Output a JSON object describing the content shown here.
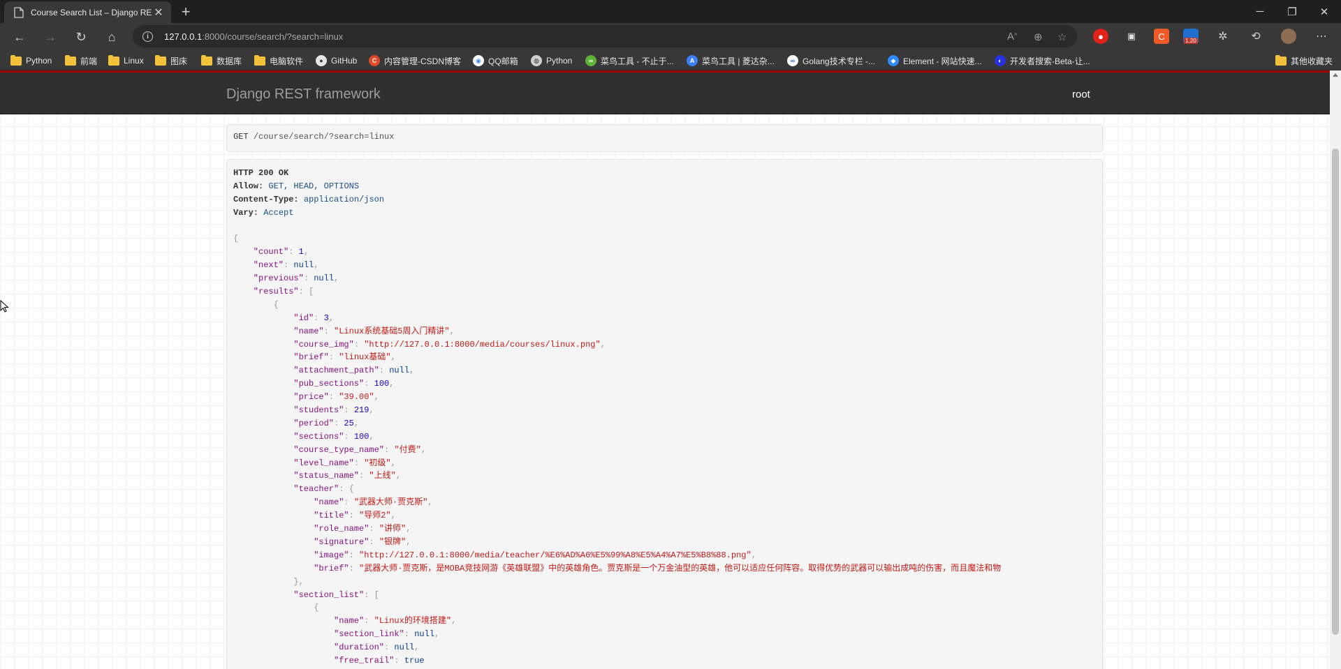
{
  "browser": {
    "tab_title": "Course Search List – Django REST",
    "url_host": "127.0.0.1",
    "url_rest": ":8000/course/search/?search=linux",
    "extensions_badge": "1.20",
    "bookmarks": [
      {
        "label": "Python",
        "icon": "folder-icon"
      },
      {
        "label": "前端",
        "icon": "folder-icon"
      },
      {
        "label": "Linux",
        "icon": "folder-icon"
      },
      {
        "label": "图床",
        "icon": "folder-icon"
      },
      {
        "label": "数据库",
        "icon": "folder-icon"
      },
      {
        "label": "电脑软件",
        "icon": "folder-icon"
      },
      {
        "label": "GitHub",
        "icon": "github-icon"
      },
      {
        "label": "内容管理-CSDN博客",
        "icon": "csdn-icon"
      },
      {
        "label": "QQ邮箱",
        "icon": "qq-mail-icon"
      },
      {
        "label": "Python",
        "icon": "python-icon"
      },
      {
        "label": "菜鸟工具 - 不止于...",
        "icon": "runoob-icon"
      },
      {
        "label": "菜鸟工具 | 菱达杂...",
        "icon": "a-circle-icon"
      },
      {
        "label": "Golang技术专栏 -...",
        "icon": "golang-icon"
      },
      {
        "label": "Element - 网站快速...",
        "icon": "element-icon"
      },
      {
        "label": "开发者搜索-Beta-让...",
        "icon": "baidu-icon"
      }
    ],
    "other_bookmarks": "其他收藏夹"
  },
  "app": {
    "brand": "Django REST framework",
    "user": "root"
  },
  "request": {
    "method": "GET",
    "path": "/course/search/?search=linux"
  },
  "response": {
    "status": "HTTP 200 OK",
    "headers": [
      {
        "key": "Allow:",
        "value": "GET, HEAD, OPTIONS"
      },
      {
        "key": "Content-Type:",
        "value": "application/json"
      },
      {
        "key": "Vary:",
        "value": "Accept"
      }
    ],
    "json_lines": [
      {
        "indent": 0,
        "parts": [
          [
            "p",
            "{"
          ]
        ]
      },
      {
        "indent": 1,
        "parts": [
          [
            "k",
            "\"count\""
          ],
          [
            "p",
            ": "
          ],
          [
            "n",
            "1"
          ],
          [
            "p",
            ","
          ]
        ]
      },
      {
        "indent": 1,
        "parts": [
          [
            "k",
            "\"next\""
          ],
          [
            "p",
            ": "
          ],
          [
            "lit",
            "null"
          ],
          [
            "p",
            ","
          ]
        ]
      },
      {
        "indent": 1,
        "parts": [
          [
            "k",
            "\"previous\""
          ],
          [
            "p",
            ": "
          ],
          [
            "lit",
            "null"
          ],
          [
            "p",
            ","
          ]
        ]
      },
      {
        "indent": 1,
        "parts": [
          [
            "k",
            "\"results\""
          ],
          [
            "p",
            ": ["
          ]
        ]
      },
      {
        "indent": 2,
        "parts": [
          [
            "p",
            "{"
          ]
        ]
      },
      {
        "indent": 3,
        "parts": [
          [
            "k",
            "\"id\""
          ],
          [
            "p",
            ": "
          ],
          [
            "n",
            "3"
          ],
          [
            "p",
            ","
          ]
        ]
      },
      {
        "indent": 3,
        "parts": [
          [
            "k",
            "\"name\""
          ],
          [
            "p",
            ": "
          ],
          [
            "s",
            "\"Linux系统基础5周入门精讲\""
          ],
          [
            "p",
            ","
          ]
        ]
      },
      {
        "indent": 3,
        "parts": [
          [
            "k",
            "\"course_img\""
          ],
          [
            "p",
            ": "
          ],
          [
            "s",
            "\"http://127.0.0.1:8000/media/courses/linux.png\""
          ],
          [
            "p",
            ","
          ]
        ]
      },
      {
        "indent": 3,
        "parts": [
          [
            "k",
            "\"brief\""
          ],
          [
            "p",
            ": "
          ],
          [
            "s",
            "\"linux基础\""
          ],
          [
            "p",
            ","
          ]
        ]
      },
      {
        "indent": 3,
        "parts": [
          [
            "k",
            "\"attachment_path\""
          ],
          [
            "p",
            ": "
          ],
          [
            "lit",
            "null"
          ],
          [
            "p",
            ","
          ]
        ]
      },
      {
        "indent": 3,
        "parts": [
          [
            "k",
            "\"pub_sections\""
          ],
          [
            "p",
            ": "
          ],
          [
            "n",
            "100"
          ],
          [
            "p",
            ","
          ]
        ]
      },
      {
        "indent": 3,
        "parts": [
          [
            "k",
            "\"price\""
          ],
          [
            "p",
            ": "
          ],
          [
            "s",
            "\"39.00\""
          ],
          [
            "p",
            ","
          ]
        ]
      },
      {
        "indent": 3,
        "parts": [
          [
            "k",
            "\"students\""
          ],
          [
            "p",
            ": "
          ],
          [
            "n",
            "219"
          ],
          [
            "p",
            ","
          ]
        ]
      },
      {
        "indent": 3,
        "parts": [
          [
            "k",
            "\"period\""
          ],
          [
            "p",
            ": "
          ],
          [
            "n",
            "25"
          ],
          [
            "p",
            ","
          ]
        ]
      },
      {
        "indent": 3,
        "parts": [
          [
            "k",
            "\"sections\""
          ],
          [
            "p",
            ": "
          ],
          [
            "n",
            "100"
          ],
          [
            "p",
            ","
          ]
        ]
      },
      {
        "indent": 3,
        "parts": [
          [
            "k",
            "\"course_type_name\""
          ],
          [
            "p",
            ": "
          ],
          [
            "s",
            "\"付费\""
          ],
          [
            "p",
            ","
          ]
        ]
      },
      {
        "indent": 3,
        "parts": [
          [
            "k",
            "\"level_name\""
          ],
          [
            "p",
            ": "
          ],
          [
            "s",
            "\"初级\""
          ],
          [
            "p",
            ","
          ]
        ]
      },
      {
        "indent": 3,
        "parts": [
          [
            "k",
            "\"status_name\""
          ],
          [
            "p",
            ": "
          ],
          [
            "s",
            "\"上线\""
          ],
          [
            "p",
            ","
          ]
        ]
      },
      {
        "indent": 3,
        "parts": [
          [
            "k",
            "\"teacher\""
          ],
          [
            "p",
            ": {"
          ]
        ]
      },
      {
        "indent": 4,
        "parts": [
          [
            "k",
            "\"name\""
          ],
          [
            "p",
            ": "
          ],
          [
            "s",
            "\"武器大师·贾克斯\""
          ],
          [
            "p",
            ","
          ]
        ]
      },
      {
        "indent": 4,
        "parts": [
          [
            "k",
            "\"title\""
          ],
          [
            "p",
            ": "
          ],
          [
            "s",
            "\"导师2\""
          ],
          [
            "p",
            ","
          ]
        ]
      },
      {
        "indent": 4,
        "parts": [
          [
            "k",
            "\"role_name\""
          ],
          [
            "p",
            ": "
          ],
          [
            "s",
            "\"讲师\""
          ],
          [
            "p",
            ","
          ]
        ]
      },
      {
        "indent": 4,
        "parts": [
          [
            "k",
            "\"signature\""
          ],
          [
            "p",
            ": "
          ],
          [
            "s",
            "\"银牌\""
          ],
          [
            "p",
            ","
          ]
        ]
      },
      {
        "indent": 4,
        "parts": [
          [
            "k",
            "\"image\""
          ],
          [
            "p",
            ": "
          ],
          [
            "s",
            "\"http://127.0.0.1:8000/media/teacher/%E6%AD%A6%E5%99%A8%E5%A4%A7%E5%B8%88.png\""
          ],
          [
            "p",
            ","
          ]
        ]
      },
      {
        "indent": 4,
        "parts": [
          [
            "k",
            "\"brief\""
          ],
          [
            "p",
            ": "
          ],
          [
            "s",
            "\"武器大师·贾克斯，是MOBA竞技网游《英雄联盟》中的英雄角色。贾克斯是一个万金油型的英雄，他可以适应任何阵容。取得优势的武器可以输出成吨的伤害，而且魔法和物"
          ]
        ]
      },
      {
        "indent": 3,
        "parts": [
          [
            "p",
            "},"
          ]
        ]
      },
      {
        "indent": 3,
        "parts": [
          [
            "k",
            "\"section_list\""
          ],
          [
            "p",
            ": ["
          ]
        ]
      },
      {
        "indent": 4,
        "parts": [
          [
            "p",
            "{"
          ]
        ]
      },
      {
        "indent": 5,
        "parts": [
          [
            "k",
            "\"name\""
          ],
          [
            "p",
            ": "
          ],
          [
            "s",
            "\"Linux的环境搭建\""
          ],
          [
            "p",
            ","
          ]
        ]
      },
      {
        "indent": 5,
        "parts": [
          [
            "k",
            "\"section_link\""
          ],
          [
            "p",
            ": "
          ],
          [
            "lit",
            "null"
          ],
          [
            "p",
            ","
          ]
        ]
      },
      {
        "indent": 5,
        "parts": [
          [
            "k",
            "\"duration\""
          ],
          [
            "p",
            ": "
          ],
          [
            "lit",
            "null"
          ],
          [
            "p",
            ","
          ]
        ]
      },
      {
        "indent": 5,
        "parts": [
          [
            "k",
            "\"free_trail\""
          ],
          [
            "p",
            ": "
          ],
          [
            "lit",
            "true"
          ]
        ]
      },
      {
        "indent": 4,
        "parts": [
          [
            "p",
            "},"
          ]
        ]
      }
    ]
  },
  "colors": {
    "accent_bar": "#a30000",
    "navbar_bg": "#2f2f2f",
    "json_key": "#881280",
    "json_string": "#c41a16",
    "json_number": "#1c00cf",
    "json_literal": "#0b3d91"
  }
}
